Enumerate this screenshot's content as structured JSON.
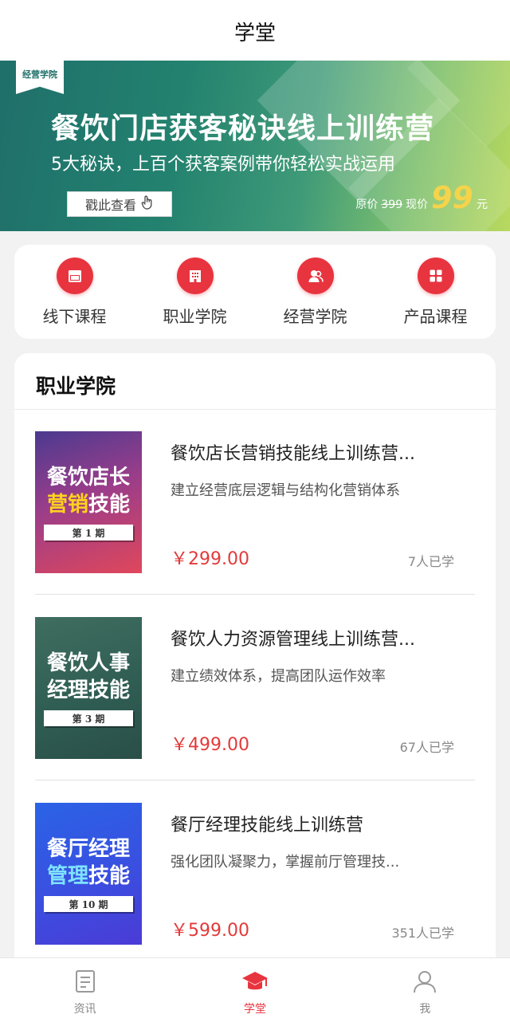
{
  "header": {
    "title": "学堂"
  },
  "banner": {
    "tag": "经营学院",
    "headline": "餐饮门店获客秘诀线上训练营",
    "subtitle": "5大秘诀，上百个获客案例带你轻松实战运用",
    "cta_label": "戳此查看",
    "original_price_label": "原价",
    "original_price": "399",
    "current_price_label": "现价",
    "current_price": "99",
    "currency_unit": "元",
    "slide_count": 2,
    "active_slide": 2
  },
  "categories": [
    {
      "label": "线下课程",
      "icon": "calendar-icon"
    },
    {
      "label": "职业学院",
      "icon": "building-icon"
    },
    {
      "label": "经营学院",
      "icon": "people-icon"
    },
    {
      "label": "产品课程",
      "icon": "grid-icon"
    }
  ],
  "section": {
    "title": "职业学院",
    "courses": [
      {
        "name": "餐饮店长营销技能线上训练营...",
        "desc": "建立经营底层逻辑与结构化营销体系",
        "price": "￥299.00",
        "learners": "7人已学",
        "cover_line1": "餐饮店长",
        "cover_line2_a": "营销",
        "cover_line2_b": "技能",
        "cover_period": "第 1 期"
      },
      {
        "name": "餐饮人力资源管理线上训练营...",
        "desc": "建立绩效体系，提高团队运作效率",
        "price": "￥499.00",
        "learners": "67人已学",
        "cover_line1": "餐饮人事",
        "cover_line2_a": "经理",
        "cover_line2_b": "技能",
        "cover_period": "第 3 期"
      },
      {
        "name": "餐厅经理技能线上训练营",
        "desc": "强化团队凝聚力，掌握前厅管理技...",
        "price": "￥599.00",
        "learners": "351人已学",
        "cover_line1": "餐厅经理",
        "cover_line2_a": "管理",
        "cover_line2_b": "技能",
        "cover_period": "第 10 期"
      }
    ]
  },
  "bottom_nav": [
    {
      "label": "资讯",
      "icon": "news-icon",
      "active": false
    },
    {
      "label": "学堂",
      "icon": "graduation-cap-icon",
      "active": true
    },
    {
      "label": "我",
      "icon": "user-icon",
      "active": false
    }
  ],
  "colors": {
    "accent": "#e8343f",
    "price": "#e33a3a",
    "banner_green": "#23826f"
  }
}
